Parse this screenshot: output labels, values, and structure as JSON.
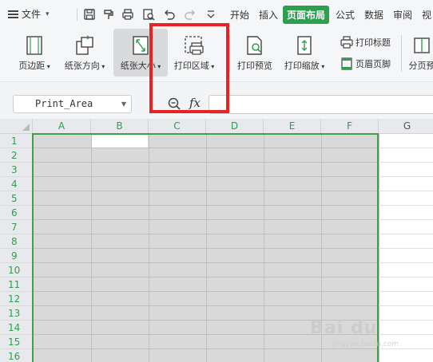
{
  "menubar": {
    "file_label": "文件",
    "tabs": [
      "开始",
      "插入",
      "页面布局",
      "公式",
      "数据",
      "审阅",
      "视"
    ],
    "active_tab": "页面布局"
  },
  "ribbon": {
    "margins": "页边距",
    "orientation": "纸张方向",
    "size": "纸张大小",
    "print_area": "打印区域",
    "print_preview": "打印预览",
    "print_scale": "打印缩放",
    "print_titles": "打印标题",
    "header_footer": "页眉页脚",
    "page_break": "分页预"
  },
  "formula_bar": {
    "name_box": "Print_Area",
    "fx_label": "fx",
    "value": ""
  },
  "sheet": {
    "columns": [
      "A",
      "B",
      "C",
      "D",
      "E",
      "F",
      "G"
    ],
    "rows": [
      "1",
      "2",
      "3",
      "4",
      "5",
      "6",
      "7",
      "8",
      "9",
      "10",
      "11",
      "12",
      "13",
      "14",
      "15",
      "16"
    ],
    "active_cell": "B1",
    "print_area": "A1:F16"
  },
  "watermark": {
    "brand": "Bai du",
    "sub": "jingyan.baidu.com"
  },
  "colors": {
    "accent": "#2e9e4f",
    "highlight_box": "#ea2222",
    "selection": "#3f9f4a",
    "print_area_fill": "#d9d9d9"
  }
}
